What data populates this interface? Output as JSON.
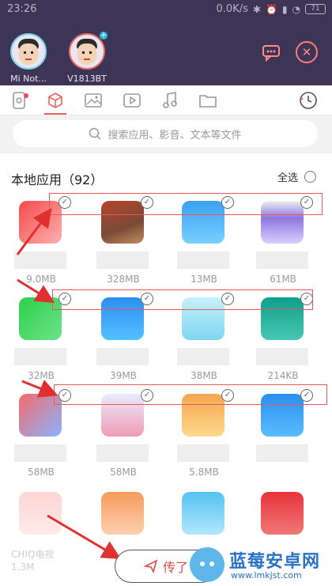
{
  "status": {
    "time": "23:26",
    "speed": "0.0K/s",
    "battery": "71"
  },
  "devices": [
    {
      "name": "Mi Not..."
    },
    {
      "name": "V1813BT"
    }
  ],
  "tabs": [
    "recent",
    "apps",
    "images",
    "videos",
    "music",
    "files"
  ],
  "search": {
    "placeholder": "搜索应用、影音、文本等文件"
  },
  "section": {
    "title": "本地应用（92）",
    "select_all": "全选"
  },
  "apps": [
    {
      "size": "9.0MB"
    },
    {
      "size": "328MB"
    },
    {
      "size": "13MB"
    },
    {
      "size": "61MB"
    },
    {
      "size": "32MB"
    },
    {
      "size": "39MB"
    },
    {
      "size": "38MB"
    },
    {
      "size": "214KB"
    },
    {
      "size": "58MB"
    },
    {
      "size": "58MB"
    },
    {
      "size": "5.8MB"
    },
    {
      "size": ""
    },
    {
      "size": ""
    },
    {
      "size": ""
    },
    {
      "size": ""
    },
    {
      "size": ""
    }
  ],
  "bottom": {
    "faded_label": "CHIQ电视",
    "faded_size": "1.3M",
    "send_label": "传了"
  },
  "watermark": {
    "brand": "蓝莓安卓网",
    "url": "www.lmkjst.com"
  },
  "colors": {
    "header": "#3c3556",
    "accent": "#f06060",
    "annotation": "#e45a5a"
  }
}
